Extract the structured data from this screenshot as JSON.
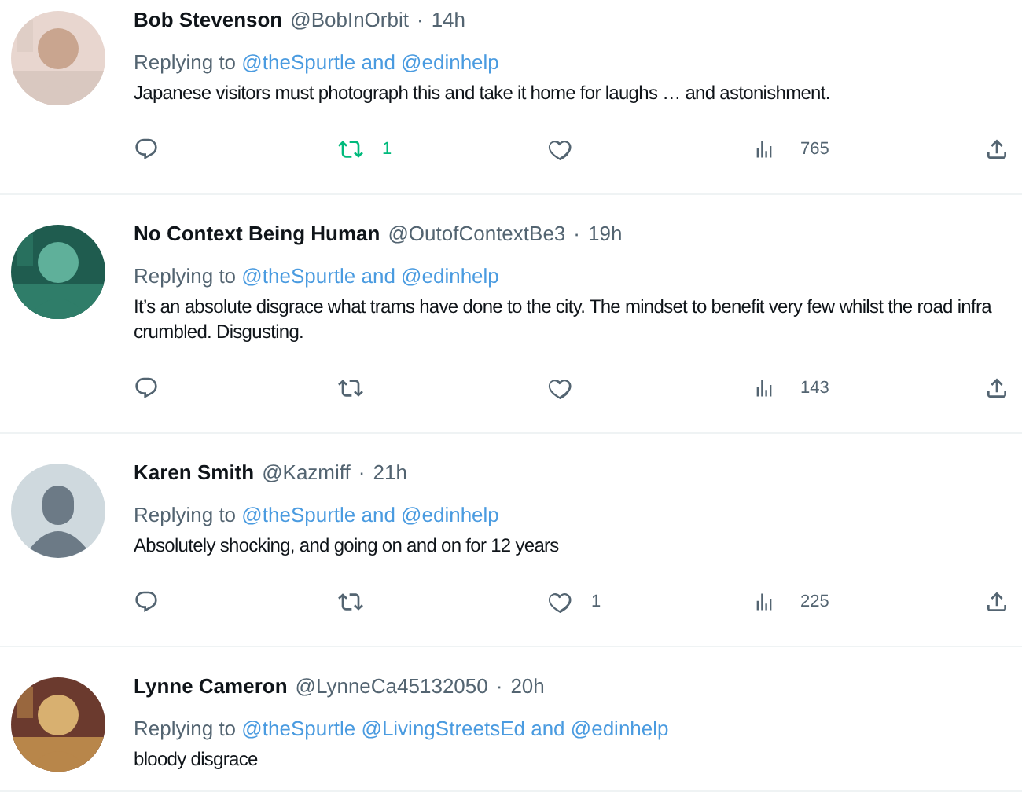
{
  "tweets": [
    {
      "avatar": {
        "kind": "picture"
      },
      "name": "Bob Stevenson",
      "handle": "@BobInOrbit",
      "separator": "·",
      "time": "14h",
      "reply_prefix": "Replying to",
      "reply_mentions": "@theSpurtle and @edinhelp",
      "body": [
        "Japanese visitors must photograph this and take it home for laughs … and astonishment."
      ],
      "actions": {
        "retweets": "1",
        "retweeted": true,
        "liked": false,
        "views": "765"
      }
    },
    {
      "avatar": {
        "kind": "picture"
      },
      "name": "No Context Being Human",
      "handle": "@OutofContextBe3",
      "separator": "·",
      "time": "19h",
      "reply_prefix": "Replying to",
      "reply_mentions": "@theSpurtle and @edinhelp",
      "body": [
        "It’s an absolute disgrace what trams have done to the city. The mindset to benefit very few whilst the road infra",
        "crumbled. Disgusting."
      ],
      "actions": {
        "retweeted": false,
        "liked": false,
        "views": "143"
      }
    },
    {
      "avatar": {
        "kind": "default"
      },
      "name": "Karen Smith",
      "handle": "@Kazmiff",
      "separator": "·",
      "time": "21h",
      "reply_prefix": "Replying to",
      "reply_mentions": "@theSpurtle and @edinhelp",
      "body": [
        "Absolutely shocking, and going on and on for 12 years"
      ],
      "actions": {
        "retweeted": false,
        "liked": false,
        "likes": "1",
        "views": "225"
      }
    },
    {
      "avatar": {
        "kind": "picture"
      },
      "name": "Lynne Cameron",
      "handle": "@LynneCa45132050",
      "separator": "·",
      "time": "20h",
      "reply_prefix": "Replying to",
      "reply_mentions": "@theSpurtle @LivingStreetsEd and @edinhelp",
      "body": [
        "bloody disgrace"
      ]
    }
  ]
}
